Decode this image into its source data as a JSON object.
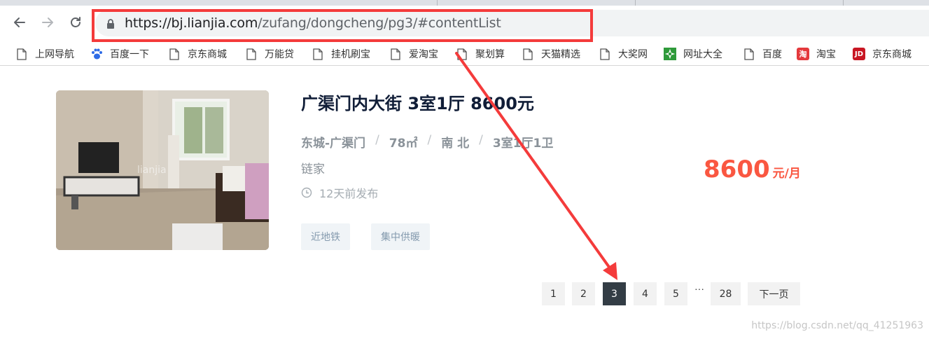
{
  "browser": {
    "address_bar": {
      "url_host": "https://bj.lianjia.com",
      "url_path": "/zufang/dongcheng/pg3/#contentList"
    },
    "bookmarks": [
      {
        "label": "上网导航",
        "icon": "page-icon"
      },
      {
        "label": "百度一下",
        "icon": "baidu-paw-icon"
      },
      {
        "label": "京东商城",
        "icon": "page-icon"
      },
      {
        "label": "万能贷",
        "icon": "page-icon"
      },
      {
        "label": "挂机刷宝",
        "icon": "page-icon"
      },
      {
        "label": "爱淘宝",
        "icon": "page-icon"
      },
      {
        "label": "聚划算",
        "icon": "page-icon"
      },
      {
        "label": "天猫精选",
        "icon": "page-icon"
      },
      {
        "label": "大奖网",
        "icon": "page-icon"
      },
      {
        "label": "网址大全",
        "icon": "green-flower-icon"
      },
      {
        "label": "百度",
        "icon": "page-icon"
      },
      {
        "label": "淘宝",
        "icon": "taobao-icon",
        "badge_text": "淘"
      },
      {
        "label": "京东商城",
        "icon": "jd-icon",
        "badge_text": "JD"
      }
    ]
  },
  "listing": {
    "title": "广渠门内大街 3室1厅 8600元",
    "district": "东城-广渠门",
    "area": "78㎡",
    "orientation": "南 北",
    "layout": "3室1厅1卫",
    "brand": "链家",
    "published": "12天前发布",
    "tags": [
      "近地铁",
      "集中供暖"
    ],
    "price": "8600",
    "price_unit": "元/月",
    "photo_watermark": "lianjia"
  },
  "pagination": {
    "pages": [
      "1",
      "2",
      "3",
      "4",
      "5"
    ],
    "ellipsis": "···",
    "last": "28",
    "next": "下一页",
    "current": "3"
  },
  "watermark": "https://blog.csdn.net/qq_41251963",
  "colors": {
    "annotation_red": "#f43b3b",
    "price_red": "#fa5741",
    "active_page": "#333d45",
    "title": "#101d37"
  }
}
